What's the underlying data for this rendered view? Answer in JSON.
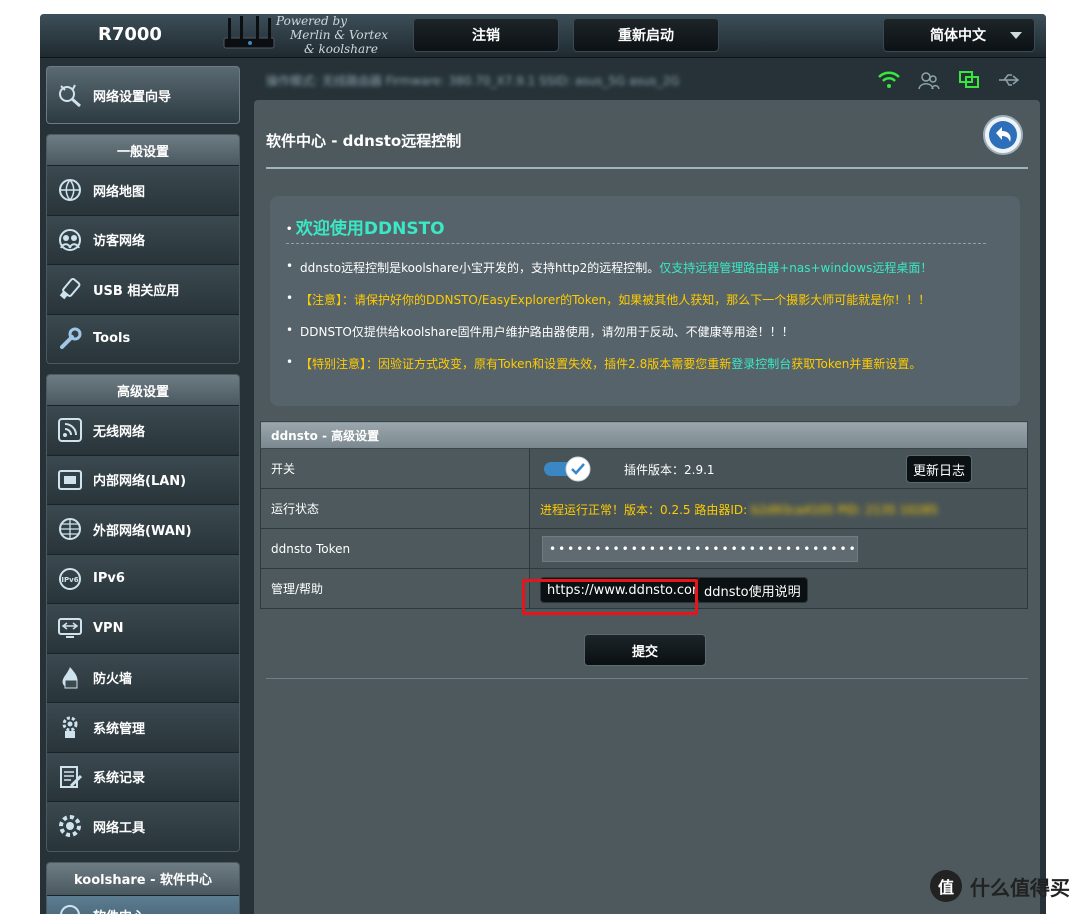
{
  "header": {
    "model": "R7000",
    "powered_lines": [
      "Powered by",
      "Merlin & Vortex",
      "& koolshare"
    ],
    "logout_label": "注销",
    "reboot_label": "重新启动",
    "language": "简体中文"
  },
  "sidebar": {
    "wizard_label": "网络设置向导",
    "general": {
      "heading": "一般设置",
      "items": [
        {
          "label": "网络地图",
          "icon": "globe-map-icon"
        },
        {
          "label": "访客网络",
          "icon": "guest-network-icon"
        },
        {
          "label": "USB 相关应用",
          "icon": "usb-icon"
        },
        {
          "label": "Tools",
          "icon": "wrench-icon"
        }
      ]
    },
    "advanced": {
      "heading": "高级设置",
      "items": [
        {
          "label": "无线网络",
          "icon": "wireless-icon"
        },
        {
          "label": "内部网络(LAN)",
          "icon": "lan-icon"
        },
        {
          "label": "外部网络(WAN)",
          "icon": "wan-globe-icon"
        },
        {
          "label": "IPv6",
          "icon": "ipv6-icon"
        },
        {
          "label": "VPN",
          "icon": "vpn-icon"
        },
        {
          "label": "防火墙",
          "icon": "firewall-icon"
        },
        {
          "label": "系统管理",
          "icon": "admin-gear-icon"
        },
        {
          "label": "系统记录",
          "icon": "syslog-icon"
        },
        {
          "label": "网络工具",
          "icon": "network-tools-gear-icon"
        }
      ]
    },
    "koolshare": {
      "heading": "koolshare - 软件中心",
      "item_label": "软件中心"
    }
  },
  "status_strip": {
    "firmware_text": "操作模式: 无线路由器  Firmware: 380.70_X7.9.1  SSID: asus_5G  asus_2G"
  },
  "main": {
    "page_title": "软件中心 - ddnsto远程控制",
    "welcome": {
      "title": "欢迎使用DDNSTO",
      "line1_white": "ddnsto远程控制是koolshare小宝开发的，支持http2的远程控制。",
      "line1_cyan": "仅支持远程管理路由器+nas+windows远程桌面！",
      "line2": "【注意】：请保护好你的DDNSTO/EasyExplorer的Token，如果被其他人获知，那么下一个摄影大师可能就是你！！！",
      "line3": "DDNSTO仅提供给koolshare固件用户维护路由器使用，请勿用于反动、不健康等用途！！！",
      "line4_a": "【特别注意】：因验证方式改变，原有Token和设置失效，插件2.8版本需要您重新",
      "line4_link": "登录控制台",
      "line4_b": "获取Token并重新设置。"
    },
    "table": {
      "heading": "ddnsto - 高级设置",
      "rows": {
        "switch_label": "开关",
        "plugin_version": "插件版本：2.9.1",
        "changelog_button": "更新日志",
        "status_label": "运行状态",
        "status_text": "进程运行正常！版本：0.2.5 路由器ID:",
        "router_id": "b2d93ca4105   PID: 2135 10285",
        "token_label": "ddnsto Token",
        "token_value": "••••••••••••••••••••••••••••••••••",
        "help_label": "管理/帮助",
        "site_button": "https://www.ddnsto.com",
        "manual_button": "ddnsto使用说明"
      }
    },
    "submit_label": "提交"
  },
  "watermark": {
    "badge": "值",
    "text": "什么值得买"
  },
  "colors": {
    "accent_cyan": "#3be8c5",
    "warn_yellow": "#ffcc00",
    "highlight_red": "#e8141c",
    "toggle_blue": "#3b87c4"
  }
}
